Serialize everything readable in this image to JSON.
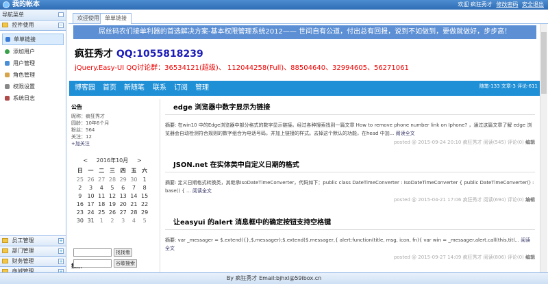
{
  "app": {
    "title": "我的帐本",
    "welcome": "欢迎 疯狂秀才",
    "change_pwd": "修改密码",
    "logout": "安全退出"
  },
  "sidebar": {
    "header": "导航菜单",
    "group": "控件使用",
    "items": [
      {
        "label": "单单链接",
        "color": "#3a7bd5"
      },
      {
        "label": "添加用户",
        "color": "#3aa14a"
      },
      {
        "label": "用户管理",
        "color": "#4a8ed8"
      },
      {
        "label": "角色管理",
        "color": "#d8a44a"
      },
      {
        "label": "权限设置",
        "color": "#888888"
      },
      {
        "label": "系统日志",
        "color": "#b04a4a"
      }
    ],
    "groups_bottom": [
      "员工管理",
      "部门管理",
      "财务管理",
      "商城管理"
    ]
  },
  "tabs": [
    {
      "label": "欢迎使用"
    },
    {
      "label": "单单链接"
    }
  ],
  "page": {
    "banner": "屌丝码农们接单利器的首选解决方案-基本权限管理系统2012—— 世间自有公道，付出总有回报，说到不如做到，要做就做好，步步高！",
    "blog_name": "疯狂秀才",
    "qq_text": "QQ:1055818239",
    "subtitle": "jQuery.Easy-UI QQ讨论群：36534121(超级)、 112044258(Full)、88504640、32994605、56271061",
    "nav": [
      "博客园",
      "首页",
      "新随笔",
      "联系",
      "订阅",
      "管理"
    ],
    "stats": "随笔-133  文章-3  评论-611",
    "notice": {
      "title": "公告",
      "lines": [
        "昵称：疯狂秀才",
        "园龄：10年6个月",
        "粉丝：564",
        "关注：12",
        "+加关注"
      ]
    },
    "calendar": {
      "caption": "2016年10月",
      "prev": "<",
      "next": ">",
      "weekdays": [
        "日",
        "一",
        "二",
        "三",
        "四",
        "五",
        "六"
      ],
      "weeks": [
        [
          "25",
          "26",
          "27",
          "28",
          "29",
          "30",
          "1"
        ],
        [
          "2",
          "3",
          "4",
          "5",
          "6",
          "7",
          "8"
        ],
        [
          "9",
          "10",
          "11",
          "12",
          "13",
          "14",
          "15"
        ],
        [
          "16",
          "17",
          "18",
          "19",
          "20",
          "21",
          "22"
        ],
        [
          "23",
          "24",
          "25",
          "26",
          "27",
          "28",
          "29"
        ],
        [
          "30",
          "31",
          "1",
          "2",
          "3",
          "4",
          "5"
        ]
      ]
    },
    "search": {
      "title": "搜索",
      "btn1": "找找看",
      "btn2": "谷歌搜索"
    },
    "posts": [
      {
        "title": "edge 浏览器中数字显示为链接",
        "desc": "摘要: 在win10 中的Edge浏览器中部分格式的数字显示链接。经过各种搜索找到一篇文章 How to remove phone number link on Iphone? ，通过这篇文章了解 edge 浏览器会自动检测符合规则的数字组合为电话号码，并加上链接的样式。去掉这个默认的功能，在head 中加...",
        "read_more": "阅读全文",
        "posted": "posted @ 2015-09-24 20:10 疯狂秀才 阅读(545) 评论(0)",
        "edit": "编辑"
      },
      {
        "title": "JSON.net 在实体类中自定义日期的格式",
        "desc": "摘要: 定义日期格式转换类，其继承IsoDateTimeConverter，代码如下：public class DateTimeConverter : IsoDateTimeConverter { public DateTimeConverter() : base() { ...",
        "read_more": "阅读全文",
        "posted": "posted @ 2015-04-21 17:06 疯狂秀才 阅读(694) 评论(0)",
        "edit": "编辑"
      },
      {
        "title": "让easyui 的alert 消息框中的确定按钮支持空格键",
        "desc": "摘要: var _messager = $.extend({},$.messager);$.extend($.messager,{ alert:function(title, msg, icon, fn){ var win = _messager.alert.call(this,titl...",
        "read_more": "阅读全文",
        "posted": "posted @ 2015-09-27 14:09 疯狂秀才 阅读(806) 评论(0)",
        "edit": "编辑"
      }
    ]
  },
  "footer": "By 疯狂秀才 Email:bjhxl@59ibox.cn"
}
